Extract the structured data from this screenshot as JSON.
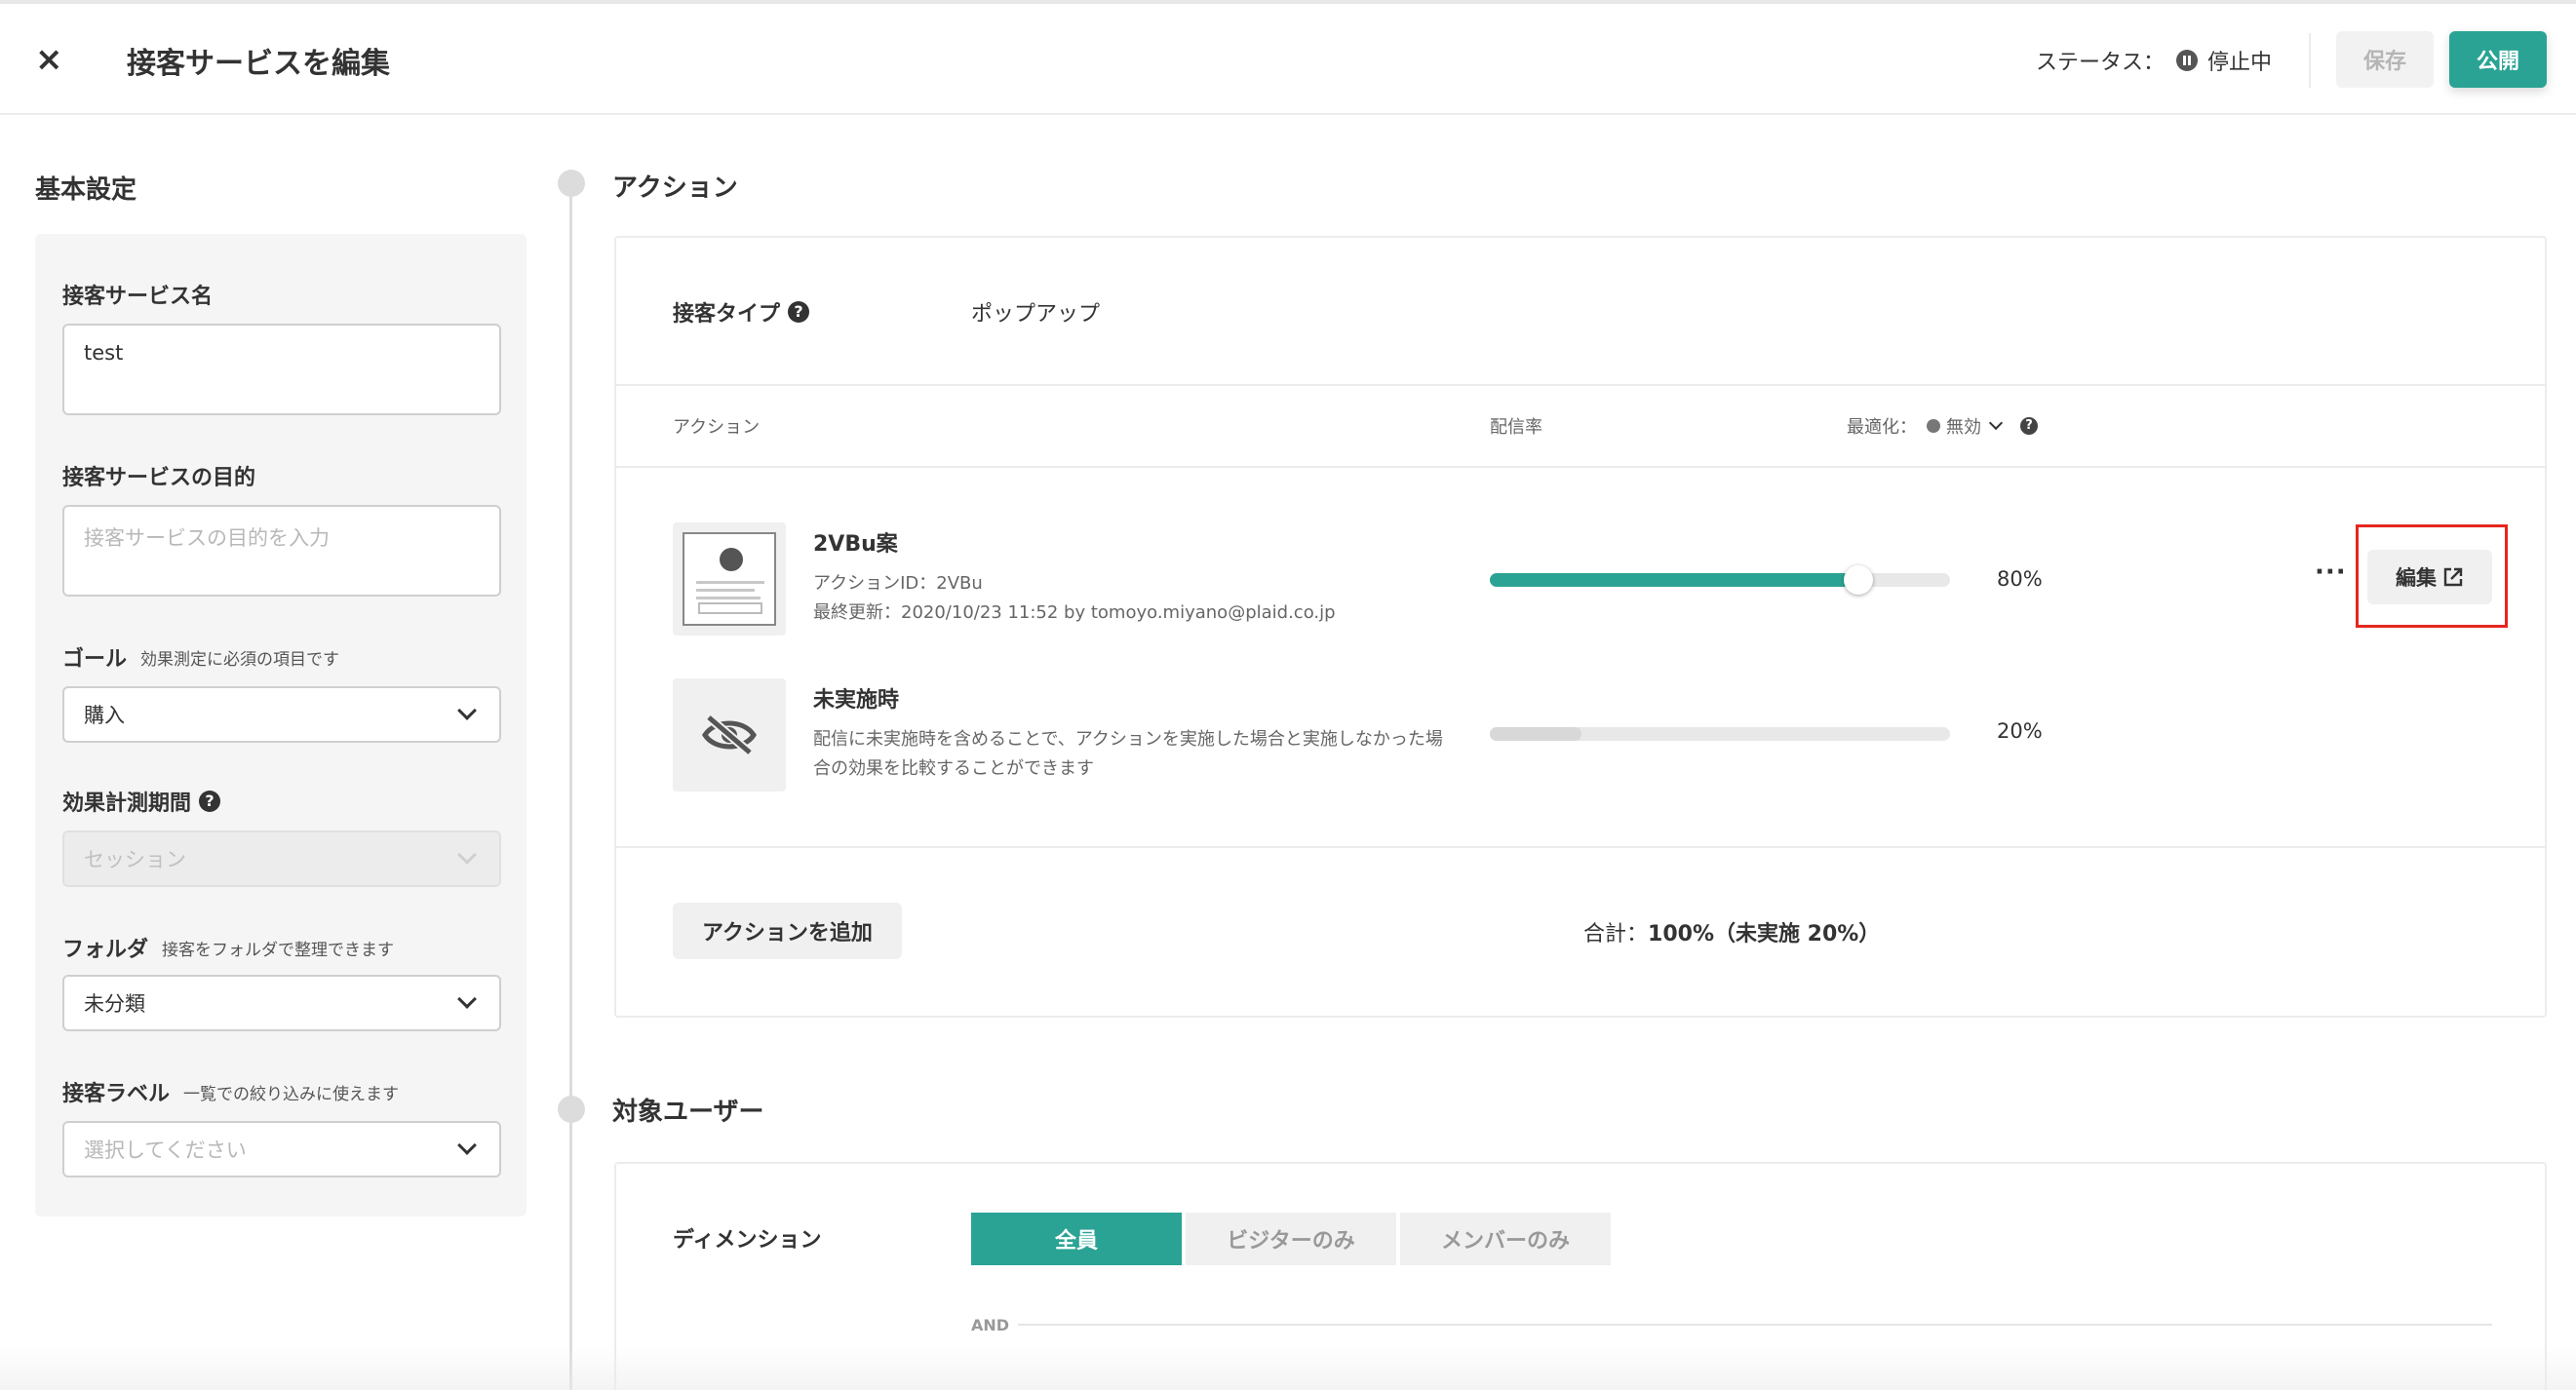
{
  "header": {
    "close_icon": "close-icon",
    "title": "接客サービスを編集",
    "status_label": "ステータス：",
    "status_value": "停止中",
    "save_label": "保存",
    "publish_label": "公開"
  },
  "basic_settings": {
    "section_title": "基本設定",
    "name_label": "接客サービス名",
    "name_value": "test",
    "purpose_label": "接客サービスの目的",
    "purpose_placeholder": "接客サービスの目的を入力",
    "goal_label": "ゴール",
    "goal_hint": "効果測定に必須の項目です",
    "goal_value": "購入",
    "period_label": "効果計測期間",
    "period_value": "セッション",
    "folder_label": "フォルダ",
    "folder_hint": "接客をフォルダで整理できます",
    "folder_value": "未分類",
    "label_label": "接客ラベル",
    "label_hint": "一覧での絞り込みに使えます",
    "label_placeholder": "選択してください"
  },
  "action_section": {
    "title": "アクション",
    "type_label": "接客タイプ",
    "type_value": "ポップアップ",
    "col_action": "アクション",
    "col_rate": "配信率",
    "optimize_label": "最適化：",
    "optimize_value": "無効",
    "items": [
      {
        "title": "2VBu案",
        "action_id": "アクションID：2VBu",
        "updated": "最終更新：2020/10/23 11:52 by tomoyo.miyano@plaid.co.jp",
        "rate": 80,
        "rate_label": "80%",
        "edit_label": "編集",
        "more": "···"
      },
      {
        "title": "未実施時",
        "desc_line1": "配信に未実施時を含めることで、アクションを実施した場合と実施しなかった場",
        "desc_line2": "合の効果を比較することができます",
        "rate": 20,
        "rate_label": "20%"
      }
    ],
    "add_label": "アクションを追加",
    "total_prefix": "合計：",
    "total_value": "100%（未実施 20%）",
    "accent_color": "#2aa394",
    "highlight_color": "#e5261e"
  },
  "target_section": {
    "title": "対象ユーザー",
    "dimension_label": "ディメンション",
    "segments": [
      "全員",
      "ビジターのみ",
      "メンバーのみ"
    ],
    "selected_segment": "全員",
    "and_label": "AND"
  }
}
